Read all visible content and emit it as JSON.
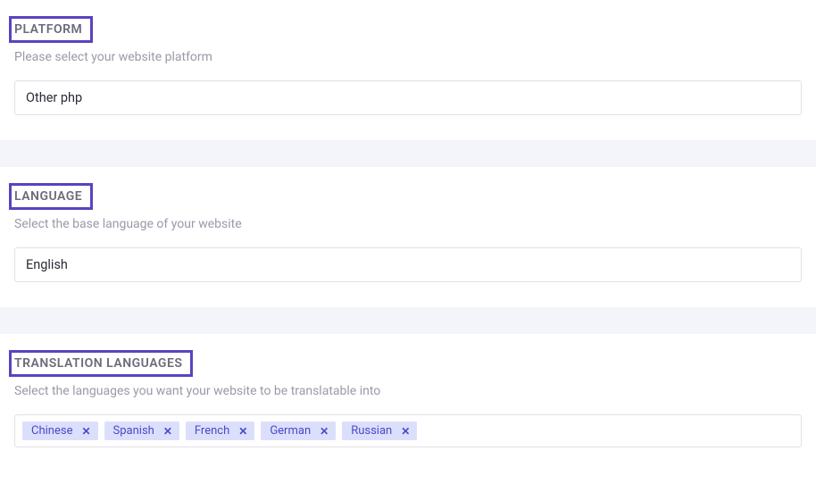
{
  "platform": {
    "heading": "PLATFORM",
    "subtitle": "Please select your website platform",
    "value": "Other php"
  },
  "language": {
    "heading": "LANGUAGE",
    "subtitle": "Select the base language of your website",
    "value": "English"
  },
  "translation": {
    "heading": "TRANSLATION LANGUAGES",
    "subtitle": "Select the languages you want your website to be translatable into",
    "tags": [
      "Chinese",
      "Spanish",
      "French",
      "German",
      "Russian"
    ]
  }
}
